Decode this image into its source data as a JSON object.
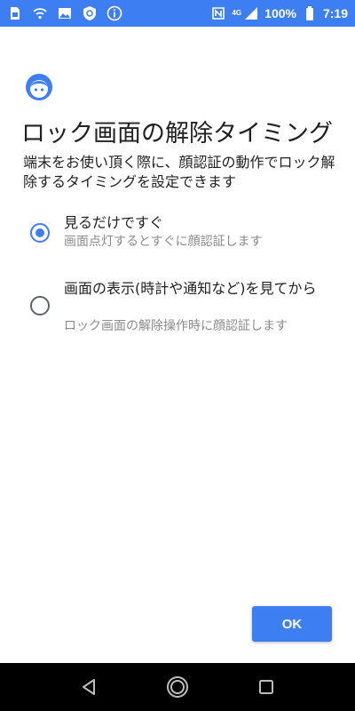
{
  "status_bar": {
    "network_label": "4G",
    "battery": "100%",
    "time": "7:19",
    "icons": [
      "sim-icon",
      "wifi-calling-icon",
      "image-icon",
      "shield-icon",
      "info-icon",
      "nfc-icon",
      "signal-icon",
      "battery-icon"
    ]
  },
  "screen": {
    "icon": "face-icon",
    "title": "ロック画面の解除タイミング",
    "description": "端末をお使い頂く際に、顔認証の動作でロック解除するタイミングを設定できます",
    "options": [
      {
        "label": "見るだけですぐ",
        "sublabel": "画面点灯するとすぐに顔認証します",
        "selected": true
      },
      {
        "label": "画面の表示(時計や通知など)を見てから",
        "sublabel": "ロック画面の解除操作時に顔認証します",
        "selected": false
      }
    ],
    "ok_label": "OK"
  },
  "nav_bar": {
    "icons": [
      "back-icon",
      "home-icon",
      "recents-icon"
    ]
  },
  "colors": {
    "accent": "#3d7ff3",
    "radio_unselected": "#5f6368",
    "secondary_text": "#8a8a8a",
    "nav_background": "#000000"
  }
}
